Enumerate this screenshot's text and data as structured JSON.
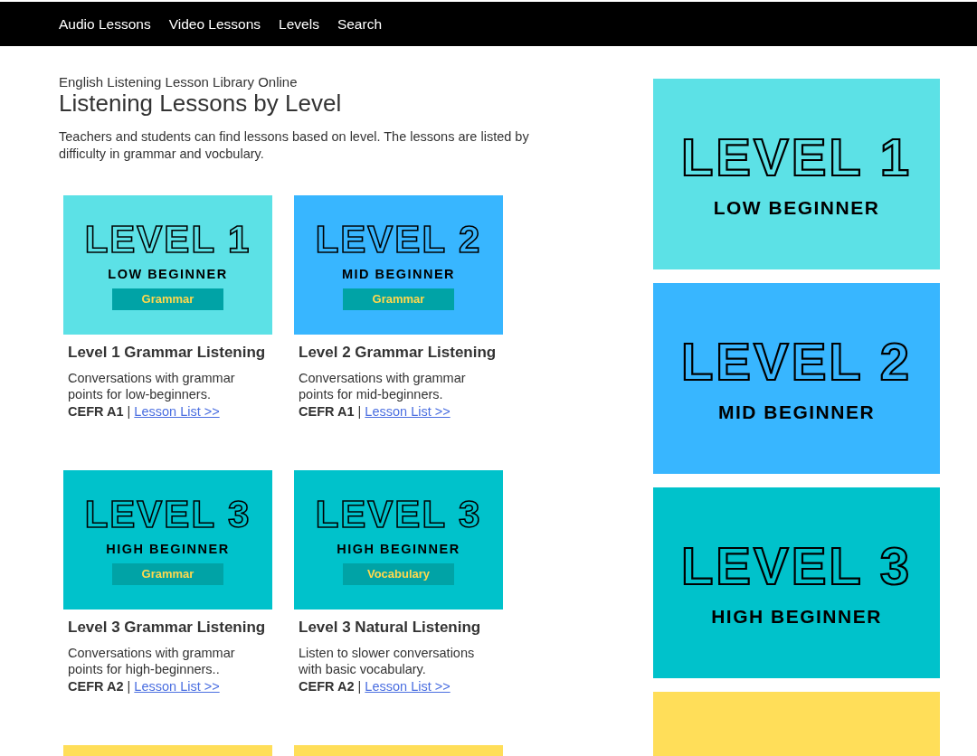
{
  "nav": {
    "items": [
      {
        "label": "Audio Lessons"
      },
      {
        "label": "Video Lessons"
      },
      {
        "label": "Levels"
      },
      {
        "label": "Search"
      }
    ]
  },
  "header": {
    "subtitle": "English Listening Lesson Library Online",
    "title": "Listening Lessons by Level",
    "intro": "Teachers and students can find lessons based on level. The lessons are listed by difficulty in grammar and vocbulary."
  },
  "cards": [
    {
      "banner": {
        "color": "#5ce1e6",
        "level_text": "LEVEL 1",
        "sublevel": "LOW BEGINNER",
        "tag": "Grammar"
      },
      "title": "Level 1 Grammar Listening",
      "description": "Conversations with grammar points for low-beginners.",
      "cefr": "CEFR A1",
      "separator": "|",
      "link": "Lesson List >>"
    },
    {
      "banner": {
        "color": "#38b6ff",
        "level_text": "LEVEL 2",
        "sublevel": "MID BEGINNER",
        "tag": "Grammar"
      },
      "title": "Level 2 Grammar Listening",
      "description": "Conversations with grammar points for mid-beginners.",
      "cefr": "CEFR A1",
      "separator": "|",
      "link": "Lesson List >>"
    },
    {
      "banner": {
        "color": "#00c2cb",
        "level_text": "LEVEL 3",
        "sublevel": "HIGH BEGINNER",
        "tag": "Grammar"
      },
      "title": "Level 3 Grammar Listening",
      "description": "Conversations with grammar points for high-beginners..",
      "cefr": "CEFR A2",
      "separator": "|",
      "link": "Lesson List >>"
    },
    {
      "banner": {
        "color": "#00c2cb",
        "level_text": "LEVEL 3",
        "sublevel": "HIGH BEGINNER",
        "tag": "Vocabulary"
      },
      "title": "Level 3 Natural Listening",
      "description": "Listen to slower conversations with basic vocabulary.",
      "cefr": "CEFR A2",
      "separator": "|",
      "link": "Lesson List >>"
    },
    {
      "banner": {
        "color": "#ffde59"
      }
    },
    {
      "banner": {
        "color": "#ffde59"
      }
    }
  ],
  "sidebar_banners": [
    {
      "color": "#5ce1e6",
      "level_text": "LEVEL 1",
      "sublevel": "LOW BEGINNER"
    },
    {
      "color": "#38b6ff",
      "level_text": "LEVEL 2",
      "sublevel": "MID BEGINNER"
    },
    {
      "color": "#00c2cb",
      "level_text": "LEVEL 3",
      "sublevel": "HIGH BEGINNER"
    },
    {
      "color": "#ffde59"
    }
  ]
}
